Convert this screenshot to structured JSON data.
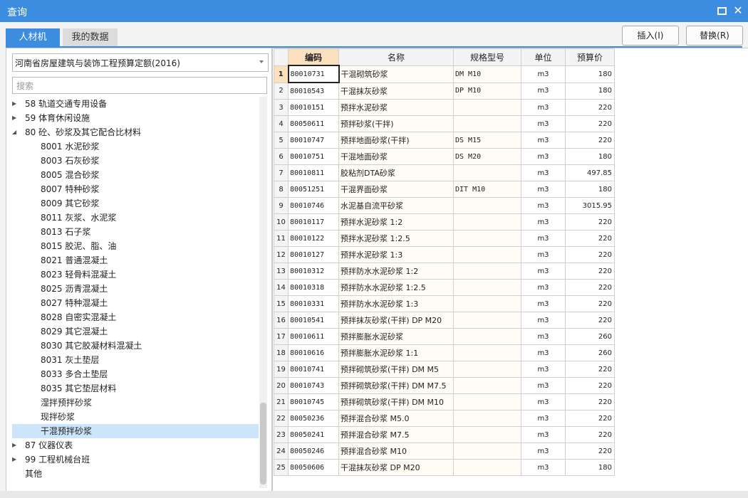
{
  "window": {
    "title": "查询"
  },
  "tabs": [
    {
      "label": "人材机"
    },
    {
      "label": "我的数据"
    }
  ],
  "buttons": {
    "insert": "插入(I)",
    "replace": "替换(R)"
  },
  "left": {
    "quota_select": "河南省房屋建筑与装饰工程预算定额(2016)",
    "search_placeholder": "搜索",
    "tree": [
      {
        "label": "58 轨道交通专用设备",
        "level": 0,
        "arrow": "collapsed"
      },
      {
        "label": "59 体育休闲设施",
        "level": 0,
        "arrow": "collapsed"
      },
      {
        "label": "80 砼、砂浆及其它配合比材料",
        "level": 0,
        "arrow": "expanded"
      },
      {
        "label": "8001 水泥砂浆",
        "level": 1
      },
      {
        "label": "8003 石灰砂浆",
        "level": 1
      },
      {
        "label": "8005 混合砂浆",
        "level": 1
      },
      {
        "label": "8007 特种砂浆",
        "level": 1
      },
      {
        "label": "8009 其它砂浆",
        "level": 1
      },
      {
        "label": "8011 灰浆、水泥浆",
        "level": 1
      },
      {
        "label": "8013 石子浆",
        "level": 1
      },
      {
        "label": "8015 胶泥、脂、油",
        "level": 1
      },
      {
        "label": "8021 普通混凝土",
        "level": 1
      },
      {
        "label": "8023 轻骨料混凝土",
        "level": 1
      },
      {
        "label": "8025 沥青混凝土",
        "level": 1
      },
      {
        "label": "8027 特种混凝土",
        "level": 1
      },
      {
        "label": "8028 自密实混凝土",
        "level": 1
      },
      {
        "label": "8029 其它混凝土",
        "level": 1
      },
      {
        "label": "8030 其它胶凝材料混凝土",
        "level": 1
      },
      {
        "label": "8031 灰土垫层",
        "level": 1
      },
      {
        "label": "8033 多合土垫层",
        "level": 1
      },
      {
        "label": "8035 其它垫层材料",
        "level": 1
      },
      {
        "label": "湿拌预拌砂浆",
        "level": 1
      },
      {
        "label": "现拌砂浆",
        "level": 1
      },
      {
        "label": "干混预拌砂浆",
        "level": 1,
        "selected": true
      },
      {
        "label": "87 仪器仪表",
        "level": 0,
        "arrow": "collapsed"
      },
      {
        "label": "99 工程机械台班",
        "level": 0,
        "arrow": "collapsed"
      },
      {
        "label": "其他",
        "level": 0
      }
    ]
  },
  "table": {
    "headers": [
      "编码",
      "名称",
      "规格型号",
      "单位",
      "预算价"
    ],
    "rows": [
      {
        "n": "1",
        "code": "80010731",
        "name": "干混砌筑砂浆",
        "spec": "DM M10",
        "unit": "m3",
        "price": "180"
      },
      {
        "n": "2",
        "code": "80010543",
        "name": "干混抹灰砂浆",
        "spec": "DP M10",
        "unit": "m3",
        "price": "180"
      },
      {
        "n": "3",
        "code": "80010151",
        "name": "预拌水泥砂浆",
        "spec": "",
        "unit": "m3",
        "price": "220"
      },
      {
        "n": "4",
        "code": "80050611",
        "name": "预拌砂浆(干拌)",
        "spec": "",
        "unit": "m3",
        "price": "220"
      },
      {
        "n": "5",
        "code": "80010747",
        "name": "预拌地面砂浆(干拌)",
        "spec": "DS M15",
        "unit": "m3",
        "price": "220"
      },
      {
        "n": "6",
        "code": "80010751",
        "name": "干混地面砂浆",
        "spec": "DS M20",
        "unit": "m3",
        "price": "180"
      },
      {
        "n": "7",
        "code": "80010811",
        "name": "胶粘剂DTA砂浆",
        "spec": "",
        "unit": "m3",
        "price": "497.85"
      },
      {
        "n": "8",
        "code": "80051251",
        "name": "干混界面砂浆",
        "spec": "DIT M10",
        "unit": "m3",
        "price": "180"
      },
      {
        "n": "9",
        "code": "80010746",
        "name": "水泥基自流平砂浆",
        "spec": "",
        "unit": "m3",
        "price": "3015.95"
      },
      {
        "n": "10",
        "code": "80010117",
        "name": "预拌水泥砂浆 1:2",
        "spec": "",
        "unit": "m3",
        "price": "220"
      },
      {
        "n": "11",
        "code": "80010122",
        "name": "预拌水泥砂浆 1:2.5",
        "spec": "",
        "unit": "m3",
        "price": "220"
      },
      {
        "n": "12",
        "code": "80010127",
        "name": "预拌水泥砂浆 1:3",
        "spec": "",
        "unit": "m3",
        "price": "220"
      },
      {
        "n": "13",
        "code": "80010312",
        "name": "预拌防水水泥砂浆 1:2",
        "spec": "",
        "unit": "m3",
        "price": "220"
      },
      {
        "n": "14",
        "code": "80010318",
        "name": "预拌防水水泥砂浆 1:2.5",
        "spec": "",
        "unit": "m3",
        "price": "220"
      },
      {
        "n": "15",
        "code": "80010331",
        "name": "预拌防水水泥砂浆 1:3",
        "spec": "",
        "unit": "m3",
        "price": "220"
      },
      {
        "n": "16",
        "code": "80010541",
        "name": "预拌抹灰砂浆(干拌) DP M20",
        "spec": "",
        "unit": "m3",
        "price": "220"
      },
      {
        "n": "17",
        "code": "80010611",
        "name": "预拌膨胀水泥砂浆",
        "spec": "",
        "unit": "m3",
        "price": "260"
      },
      {
        "n": "18",
        "code": "80010616",
        "name": "预拌膨胀水泥砂浆 1:1",
        "spec": "",
        "unit": "m3",
        "price": "260"
      },
      {
        "n": "19",
        "code": "80010741",
        "name": "预拌砌筑砂浆(干拌) DM M5",
        "spec": "",
        "unit": "m3",
        "price": "220"
      },
      {
        "n": "20",
        "code": "80010743",
        "name": "预拌砌筑砂浆(干拌) DM M7.5",
        "spec": "",
        "unit": "m3",
        "price": "220"
      },
      {
        "n": "21",
        "code": "80010745",
        "name": "预拌砌筑砂浆(干拌) DM M10",
        "spec": "",
        "unit": "m3",
        "price": "220"
      },
      {
        "n": "22",
        "code": "80050236",
        "name": "预拌混合砂浆 M5.0",
        "spec": "",
        "unit": "m3",
        "price": "220"
      },
      {
        "n": "23",
        "code": "80050241",
        "name": "预拌混合砂浆 M7.5",
        "spec": "",
        "unit": "m3",
        "price": "220"
      },
      {
        "n": "24",
        "code": "80050246",
        "name": "预拌混合砂浆 M10",
        "spec": "",
        "unit": "m3",
        "price": "220"
      },
      {
        "n": "25",
        "code": "80050606",
        "name": "干混抹灰砂浆 DP M20",
        "spec": "",
        "unit": "m3",
        "price": "180"
      }
    ]
  }
}
